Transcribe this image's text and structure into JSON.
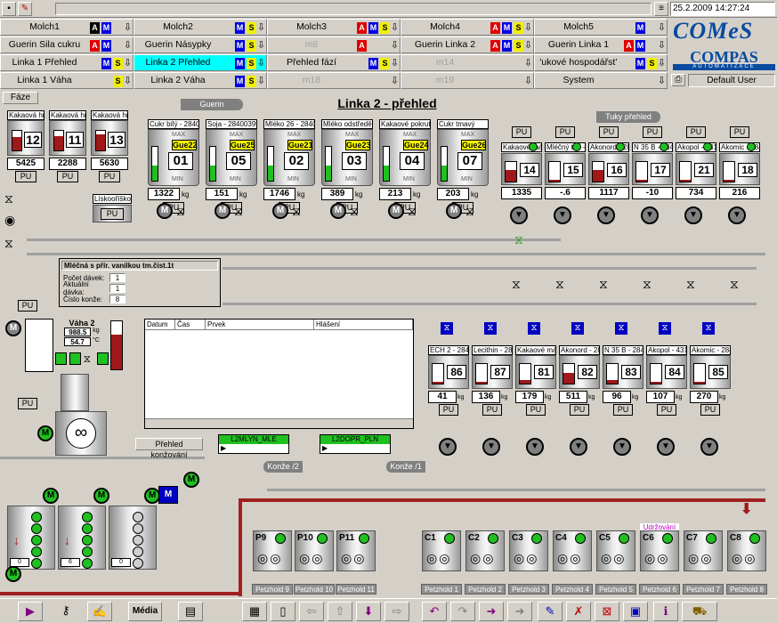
{
  "topbar": {
    "datetime": "25.2.2009 14:27:24",
    "user": "Default User"
  },
  "brand": {
    "logo1": "COMeS",
    "logo2": "COMPAS",
    "logo2_sub": "AUTOMATIZACE"
  },
  "grid": {
    "rows": [
      [
        {
          "label": "Molch1",
          "badges": [
            "K",
            "M"
          ]
        },
        {
          "label": "Molch2",
          "badges": [
            "M",
            "S"
          ]
        },
        {
          "label": "Molch3",
          "badges": [
            "A",
            "M",
            "S"
          ]
        },
        {
          "label": "Molch4",
          "badges": [
            "A",
            "M",
            "S"
          ]
        },
        {
          "label": "Molch5",
          "badges": [
            "M"
          ]
        }
      ],
      [
        {
          "label": "Guerin Sila cukru",
          "badges": [
            "A",
            "M"
          ]
        },
        {
          "label": "Guerin Násypky",
          "badges": [
            "M",
            "S"
          ]
        },
        {
          "label": "m8",
          "badges": [
            "A"
          ]
        },
        {
          "label": "Guerin Linka 2",
          "badges": [
            "A",
            "M",
            "S"
          ]
        },
        {
          "label": "Guerin Linka 1",
          "badges": [
            "A",
            "M"
          ]
        }
      ],
      [
        {
          "label": "Linka 1 Přehled",
          "badges": [
            "M",
            "S"
          ]
        },
        {
          "label": "Linka 2 Přehled",
          "badges": [
            "M",
            "S"
          ]
        },
        {
          "label": "Přehled fází",
          "badges": [
            "M",
            "S"
          ]
        },
        {
          "label": "m14",
          "badges": []
        },
        {
          "label": "'ukové hospodářst’",
          "badges": [
            "M",
            "S"
          ]
        }
      ],
      [
        {
          "label": "Linka 1 Váha",
          "badges": [
            "S"
          ]
        },
        {
          "label": "Linka 2 Váha",
          "badges": [
            "M",
            "S"
          ]
        },
        {
          "label": "m18",
          "badges": []
        },
        {
          "label": "m19",
          "badges": []
        },
        {
          "label": "System",
          "badges": []
        }
      ]
    ]
  },
  "faze_label": "Fáze",
  "page_title": "Linka 2 - přehled",
  "guerin_tag": "Guerin",
  "tuky_tag": "Tuky přehled",
  "left_tanks": [
    {
      "label": "Kakaová hm",
      "num": "12",
      "val": "5425",
      "pu": "PU"
    },
    {
      "label": "Kakaová hm",
      "num": "11",
      "val": "2288",
      "pu": "PU"
    },
    {
      "label": "Kakaová hm",
      "num": "13",
      "val": "5630",
      "pu": "PU"
    }
  ],
  "liskoo": {
    "label": "Lískooříškov",
    "pu": "PU"
  },
  "silos": [
    {
      "label": "Cukr bílý - 2840",
      "gue": "Gue22",
      "num": "01",
      "val": "1322",
      "unit": "kg",
      "pu": "PU"
    },
    {
      "label": "Soja - 28400399",
      "gue": "Gue25",
      "num": "05",
      "val": "151",
      "unit": "kg",
      "pu": "PU"
    },
    {
      "label": "Mléko 26 - 2840",
      "gue": "Gue21",
      "num": "02",
      "val": "1746",
      "unit": "kg",
      "pu": "PU"
    },
    {
      "label": "Mléko odstředě",
      "gue": "Gue23",
      "num": "03",
      "val": "389",
      "unit": "kg",
      "pu": "PU"
    },
    {
      "label": "Kakaové pokrut",
      "gue": "Gue24",
      "num": "04",
      "val": "213",
      "unit": "kg",
      "pu": "PU"
    },
    {
      "label": "Cukr tmavý",
      "gue": "Gue26",
      "num": "07",
      "val": "203",
      "unit": "kg",
      "pu": "PU"
    }
  ],
  "silo_max": "MAX",
  "silo_min": "MIN",
  "fat_tanks": [
    {
      "label": "Kakaové má",
      "num": "14",
      "val": "1335",
      "pu": "PU"
    },
    {
      "label": "Mléčný tuk -",
      "num": "15",
      "val": "-.6",
      "pu": "PU"
    },
    {
      "label": "Akonord - 28",
      "num": "16",
      "val": "1117",
      "pu": "PU"
    },
    {
      "label": "N 35 B - 284",
      "num": "17",
      "val": "-10",
      "pu": "PU"
    },
    {
      "label": "Akopol - 431",
      "num": "21",
      "val": "734",
      "pu": "PU"
    },
    {
      "label": "Akomic - 284",
      "num": "18",
      "val": "216",
      "pu": "PU"
    }
  ],
  "weigh_tanks": [
    {
      "label": "ECH 2 - 2840",
      "num": "86",
      "val": "41",
      "unit": "kg",
      "pu": "PU"
    },
    {
      "label": "Lecithin - 284",
      "num": "87",
      "val": "136",
      "unit": "kg",
      "pu": "PU"
    },
    {
      "label": "Kakaové má",
      "num": "81",
      "val": "179",
      "unit": "kg",
      "pu": "PU"
    },
    {
      "label": "Akonord - 28",
      "num": "82",
      "val": "511",
      "unit": "kg",
      "pu": "PU"
    },
    {
      "label": "N 35 B - 284",
      "num": "83",
      "val": "96",
      "unit": "kg",
      "pu": "PU"
    },
    {
      "label": "Akopol - 431",
      "num": "84",
      "val": "107",
      "unit": "kg",
      "pu": "PU"
    },
    {
      "label": "Akomic - 284",
      "num": "85",
      "val": "270",
      "unit": "kg",
      "pu": "PU"
    }
  ],
  "popup": {
    "title": "Mléčná s přír. vanilkou tm.čist.1t",
    "rows": [
      {
        "label": "Počet dávek:",
        "val": "1"
      },
      {
        "label": "Aktuální dávka:",
        "val": "1"
      },
      {
        "label": "Číslo konže:",
        "val": "8"
      }
    ]
  },
  "vaha": {
    "label": "Váha 2",
    "v1": "988.5",
    "u1": "kg",
    "v2": "54.7",
    "u2": "°C",
    "pu": "PU",
    "pu2": "PU"
  },
  "table": {
    "headers": [
      "Datum",
      "Čas",
      "Prvek",
      "Hlášení"
    ]
  },
  "konz_btn": "Přehled konžování",
  "mills": [
    {
      "label": "L2MLYN_MLE"
    },
    {
      "label": "L2DOPR_PLN"
    }
  ],
  "konze2": "Konže /2",
  "konze1": "Konže /1",
  "conches": [
    {
      "id": "P9",
      "pet": "Petzhold 9"
    },
    {
      "id": "P10",
      "pet": "Petzhold 10"
    },
    {
      "id": "P11",
      "pet": "Petzhold 11"
    },
    {
      "id": "C1",
      "pet": "Petzhold 1"
    },
    {
      "id": "C2",
      "pet": "Petzhold 2"
    },
    {
      "id": "C3",
      "pet": "Petzhold 3"
    },
    {
      "id": "C4",
      "pet": "Petzhold 4"
    },
    {
      "id": "C5",
      "pet": "Petzhold 5"
    },
    {
      "id": "C6",
      "pet": "Petzhold 6",
      "status": "Udržování"
    },
    {
      "id": "C7",
      "pet": "Petzhold 7"
    },
    {
      "id": "C8",
      "pet": "Petzhold 8"
    }
  ],
  "mixers": [
    {
      "pct": "0"
    },
    {
      "pct": "6"
    },
    {
      "pct": "0"
    }
  ],
  "bottom": {
    "media": "Média"
  },
  "colors": {
    "bg": "#d4d0c8",
    "accent_cyan": "#00ffff",
    "alarm_red": "#e00000",
    "manual_blue": "#0000e0",
    "ok_green": "#20c020",
    "gue_yellow": "#ffff00",
    "udrz_magenta": "#c000c0"
  }
}
